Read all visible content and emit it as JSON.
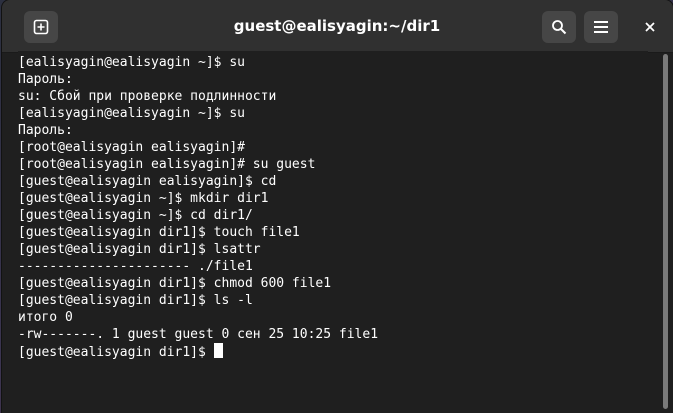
{
  "window": {
    "title": "guest@ealisyagin:~/dir1"
  },
  "icons": {
    "new_tab": "new-tab-icon",
    "search": "search-icon",
    "menu": "hamburger-menu-icon",
    "close": "close-icon"
  },
  "colors": {
    "titlebar": "#303030",
    "terminal_bg": "#1f1f1f",
    "text": "#ffffff"
  },
  "terminal": {
    "lines": [
      "[ealisyagin@ealisyagin ~]$ su",
      "Пароль:",
      "su: Сбой при проверке подлинности",
      "[ealisyagin@ealisyagin ~]$ su",
      "Пароль:",
      "[root@ealisyagin ealisyagin]#",
      "[root@ealisyagin ealisyagin]# su guest",
      "[guest@ealisyagin ealisyagin]$ cd",
      "[guest@ealisyagin ~]$ mkdir dir1",
      "[guest@ealisyagin ~]$ cd dir1/",
      "[guest@ealisyagin dir1]$ touch file1",
      "[guest@ealisyagin dir1]$ lsattr",
      "---------------------- ./file1",
      "[guest@ealisyagin dir1]$ chmod 600 file1",
      "[guest@ealisyagin dir1]$ ls -l",
      "итого 0",
      "-rw-------. 1 guest guest 0 сен 25 10:25 file1"
    ],
    "prompt": "[guest@ealisyagin dir1]$"
  }
}
